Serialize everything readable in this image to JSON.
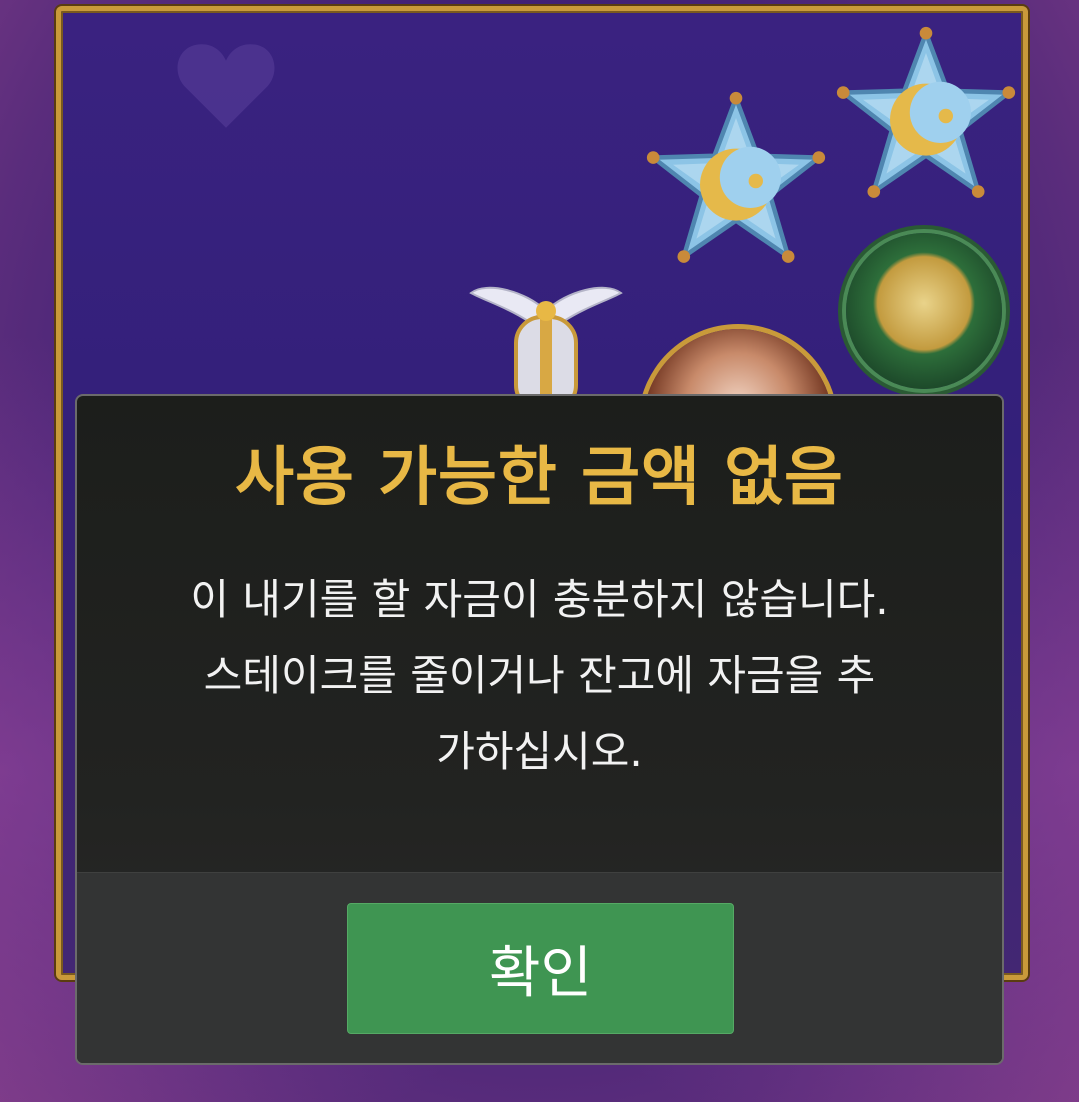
{
  "dialog": {
    "title": "사용 가능한 금액 없음",
    "message_line1": "이 내기를 할 자금이 충분하지 않습니다.",
    "message_line2": "스테이크를 줄이거나 잔고에 자금을 추",
    "message_line3": "가하십시오.",
    "confirm_label": "확인"
  },
  "colors": {
    "title": "#e8b845",
    "confirm_button": "#3f9552",
    "frame_gold": "#c99a3a",
    "background_purple": "#3a2280"
  },
  "icons": {
    "star_symbol_1": "moon-star-icon",
    "star_symbol_2": "moon-star-icon",
    "medal_symbol": "green-medal-icon",
    "winged_symbol": "winged-brooch-icon",
    "portrait_symbol": "character-portrait-icon",
    "heart": "heart-icon"
  }
}
